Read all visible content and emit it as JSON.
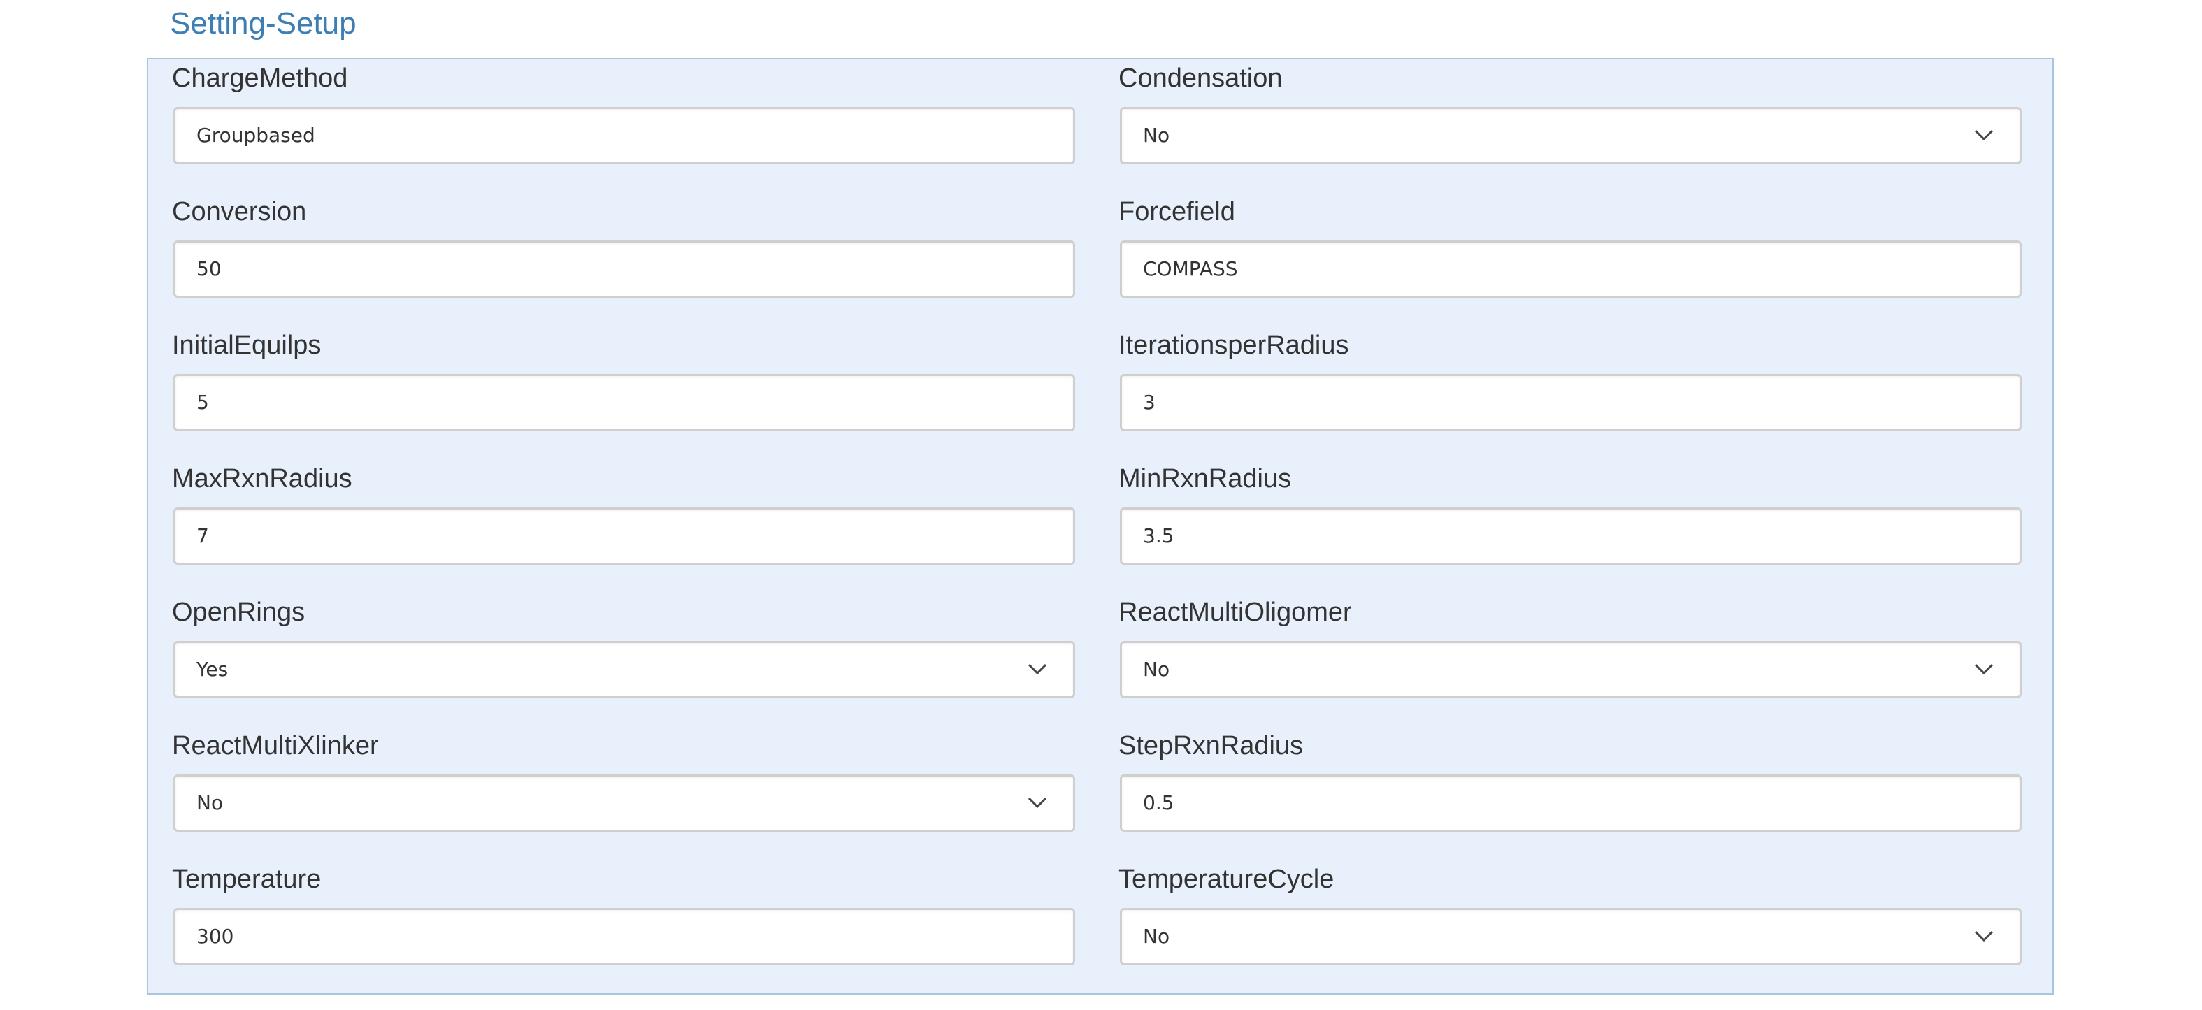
{
  "section": {
    "title": "Setting-Setup"
  },
  "fields": [
    {
      "label": "ChargeMethod",
      "value": "Groupbased",
      "type": "text"
    },
    {
      "label": "Condensation",
      "value": "No",
      "type": "select"
    },
    {
      "label": "Conversion",
      "value": "50",
      "type": "text"
    },
    {
      "label": "Forcefield",
      "value": "COMPASS",
      "type": "text"
    },
    {
      "label": "InitialEquilps",
      "value": "5",
      "type": "text"
    },
    {
      "label": "IterationsperRadius",
      "value": "3",
      "type": "text"
    },
    {
      "label": "MaxRxnRadius",
      "value": "7",
      "type": "text"
    },
    {
      "label": "MinRxnRadius",
      "value": "3.5",
      "type": "text"
    },
    {
      "label": "OpenRings",
      "value": "Yes",
      "type": "select"
    },
    {
      "label": "ReactMultiOligomer",
      "value": "No",
      "type": "select"
    },
    {
      "label": "ReactMultiXlinker",
      "value": "No",
      "type": "select"
    },
    {
      "label": "StepRxnRadius",
      "value": "0.5",
      "type": "text"
    },
    {
      "label": "Temperature",
      "value": "300",
      "type": "text"
    },
    {
      "label": "TemperatureCycle",
      "value": "No",
      "type": "select"
    }
  ],
  "icons": {
    "dropdown": "chevron-down-icon"
  },
  "colors": {
    "title": "#3d7fb5",
    "panel_background": "#e7f0fb",
    "panel_border": "#a8c6e0"
  }
}
